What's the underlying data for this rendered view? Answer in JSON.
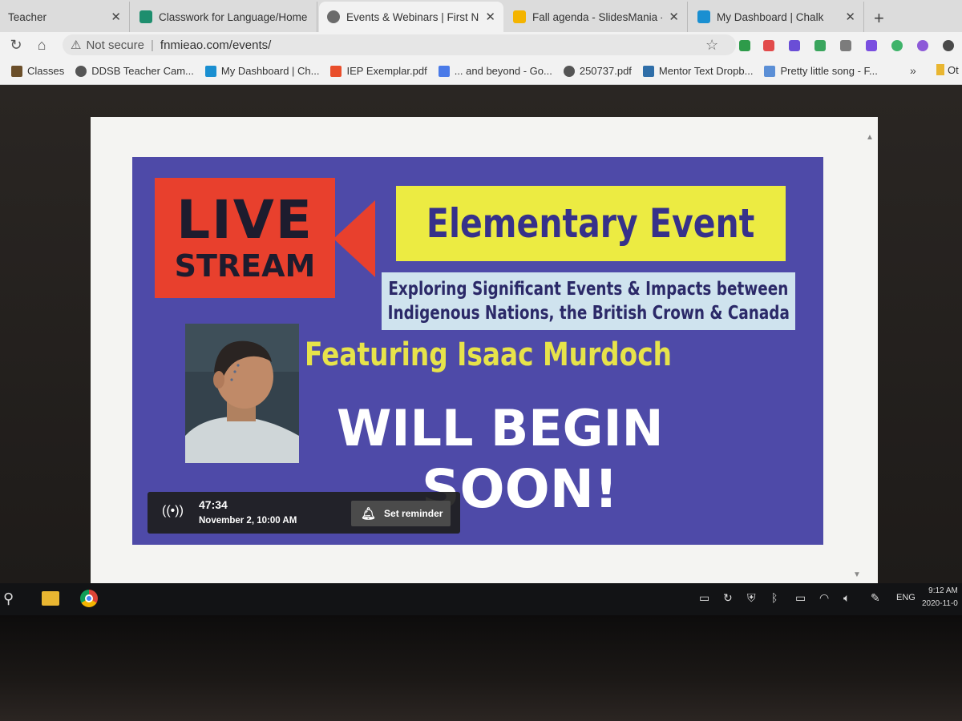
{
  "browser": {
    "tabs": [
      {
        "label": "Teacher",
        "color": "#777777"
      },
      {
        "label": "Classwork for Language/Home",
        "color": "#1e8e6e"
      },
      {
        "label": "Events & Webinars | First Natio",
        "color": "#6b6b6b"
      },
      {
        "label": "Fall agenda - SlidesMania - Go",
        "color": "#f4b400"
      },
      {
        "label": "My Dashboard | Chalk",
        "color": "#1a8fd1"
      }
    ],
    "active_tab_index": 2,
    "close_glyph": "✕",
    "new_tab_glyph": "+",
    "address": {
      "security_label": "Not secure",
      "url": "fnmieao.com/events/"
    },
    "bookmarks": [
      {
        "label": "Classes",
        "color": "#6b4f2a"
      },
      {
        "label": "DDSB Teacher Cam...",
        "color": "#555555"
      },
      {
        "label": "My Dashboard | Ch...",
        "color": "#1a8fd1"
      },
      {
        "label": "IEP Exemplar.pdf",
        "color": "#e94e2b"
      },
      {
        "label": "... and beyond - Go...",
        "color": "#4a7ae8"
      },
      {
        "label": "250737.pdf",
        "color": "#555555"
      },
      {
        "label": "Mentor Text Dropb...",
        "color": "#2f6ea8"
      },
      {
        "label": "Pretty little song - F...",
        "color": "#5b8fd6"
      }
    ],
    "bookmarks_more": "»",
    "bookmarks_other": "Ot"
  },
  "banner": {
    "live": "LIVE",
    "stream": "STREAM",
    "title": "Elementary Event",
    "subtitle_line1": "Exploring Significant Events & Impacts between",
    "subtitle_line2": "Indigenous Nations, the British Crown & Canada",
    "featuring": "Featuring Isaac Murdoch",
    "will_begin": "WILL BEGIN",
    "soon": "SOON!",
    "colors": {
      "background": "#4e4aa8",
      "live_red": "#e8402d",
      "title_yellow": "#eceb42",
      "subtitle_blue": "#cfe3ee"
    }
  },
  "player": {
    "countdown": "47:34",
    "scheduled": "November 2, 10:00 AM",
    "reminder_label": "Set reminder"
  },
  "taskbar": {
    "language": "ENG",
    "time": "9:12 AM",
    "date": "2020-11-0"
  }
}
